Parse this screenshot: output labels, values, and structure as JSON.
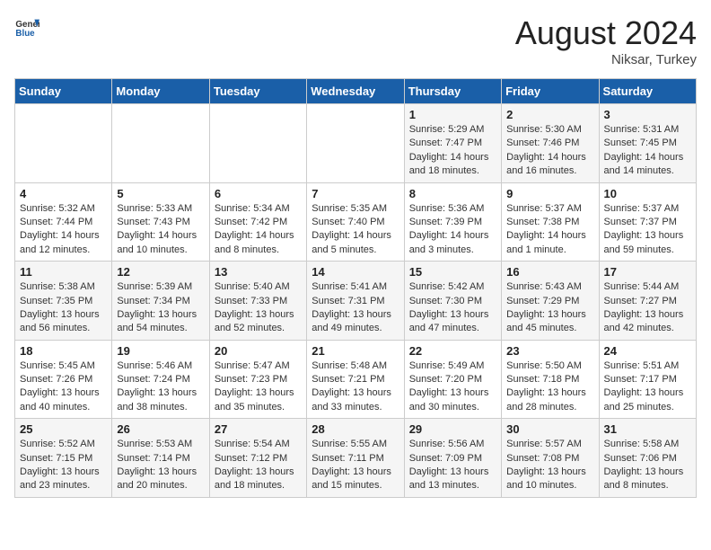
{
  "header": {
    "logo_general": "General",
    "logo_blue": "Blue",
    "month_year": "August 2024",
    "location": "Niksar, Turkey"
  },
  "weekdays": [
    "Sunday",
    "Monday",
    "Tuesday",
    "Wednesday",
    "Thursday",
    "Friday",
    "Saturday"
  ],
  "weeks": [
    [
      {
        "day": "",
        "info": ""
      },
      {
        "day": "",
        "info": ""
      },
      {
        "day": "",
        "info": ""
      },
      {
        "day": "",
        "info": ""
      },
      {
        "day": "1",
        "info": "Sunrise: 5:29 AM\nSunset: 7:47 PM\nDaylight: 14 hours\nand 18 minutes."
      },
      {
        "day": "2",
        "info": "Sunrise: 5:30 AM\nSunset: 7:46 PM\nDaylight: 14 hours\nand 16 minutes."
      },
      {
        "day": "3",
        "info": "Sunrise: 5:31 AM\nSunset: 7:45 PM\nDaylight: 14 hours\nand 14 minutes."
      }
    ],
    [
      {
        "day": "4",
        "info": "Sunrise: 5:32 AM\nSunset: 7:44 PM\nDaylight: 14 hours\nand 12 minutes."
      },
      {
        "day": "5",
        "info": "Sunrise: 5:33 AM\nSunset: 7:43 PM\nDaylight: 14 hours\nand 10 minutes."
      },
      {
        "day": "6",
        "info": "Sunrise: 5:34 AM\nSunset: 7:42 PM\nDaylight: 14 hours\nand 8 minutes."
      },
      {
        "day": "7",
        "info": "Sunrise: 5:35 AM\nSunset: 7:40 PM\nDaylight: 14 hours\nand 5 minutes."
      },
      {
        "day": "8",
        "info": "Sunrise: 5:36 AM\nSunset: 7:39 PM\nDaylight: 14 hours\nand 3 minutes."
      },
      {
        "day": "9",
        "info": "Sunrise: 5:37 AM\nSunset: 7:38 PM\nDaylight: 14 hours\nand 1 minute."
      },
      {
        "day": "10",
        "info": "Sunrise: 5:37 AM\nSunset: 7:37 PM\nDaylight: 13 hours\nand 59 minutes."
      }
    ],
    [
      {
        "day": "11",
        "info": "Sunrise: 5:38 AM\nSunset: 7:35 PM\nDaylight: 13 hours\nand 56 minutes."
      },
      {
        "day": "12",
        "info": "Sunrise: 5:39 AM\nSunset: 7:34 PM\nDaylight: 13 hours\nand 54 minutes."
      },
      {
        "day": "13",
        "info": "Sunrise: 5:40 AM\nSunset: 7:33 PM\nDaylight: 13 hours\nand 52 minutes."
      },
      {
        "day": "14",
        "info": "Sunrise: 5:41 AM\nSunset: 7:31 PM\nDaylight: 13 hours\nand 49 minutes."
      },
      {
        "day": "15",
        "info": "Sunrise: 5:42 AM\nSunset: 7:30 PM\nDaylight: 13 hours\nand 47 minutes."
      },
      {
        "day": "16",
        "info": "Sunrise: 5:43 AM\nSunset: 7:29 PM\nDaylight: 13 hours\nand 45 minutes."
      },
      {
        "day": "17",
        "info": "Sunrise: 5:44 AM\nSunset: 7:27 PM\nDaylight: 13 hours\nand 42 minutes."
      }
    ],
    [
      {
        "day": "18",
        "info": "Sunrise: 5:45 AM\nSunset: 7:26 PM\nDaylight: 13 hours\nand 40 minutes."
      },
      {
        "day": "19",
        "info": "Sunrise: 5:46 AM\nSunset: 7:24 PM\nDaylight: 13 hours\nand 38 minutes."
      },
      {
        "day": "20",
        "info": "Sunrise: 5:47 AM\nSunset: 7:23 PM\nDaylight: 13 hours\nand 35 minutes."
      },
      {
        "day": "21",
        "info": "Sunrise: 5:48 AM\nSunset: 7:21 PM\nDaylight: 13 hours\nand 33 minutes."
      },
      {
        "day": "22",
        "info": "Sunrise: 5:49 AM\nSunset: 7:20 PM\nDaylight: 13 hours\nand 30 minutes."
      },
      {
        "day": "23",
        "info": "Sunrise: 5:50 AM\nSunset: 7:18 PM\nDaylight: 13 hours\nand 28 minutes."
      },
      {
        "day": "24",
        "info": "Sunrise: 5:51 AM\nSunset: 7:17 PM\nDaylight: 13 hours\nand 25 minutes."
      }
    ],
    [
      {
        "day": "25",
        "info": "Sunrise: 5:52 AM\nSunset: 7:15 PM\nDaylight: 13 hours\nand 23 minutes."
      },
      {
        "day": "26",
        "info": "Sunrise: 5:53 AM\nSunset: 7:14 PM\nDaylight: 13 hours\nand 20 minutes."
      },
      {
        "day": "27",
        "info": "Sunrise: 5:54 AM\nSunset: 7:12 PM\nDaylight: 13 hours\nand 18 minutes."
      },
      {
        "day": "28",
        "info": "Sunrise: 5:55 AM\nSunset: 7:11 PM\nDaylight: 13 hours\nand 15 minutes."
      },
      {
        "day": "29",
        "info": "Sunrise: 5:56 AM\nSunset: 7:09 PM\nDaylight: 13 hours\nand 13 minutes."
      },
      {
        "day": "30",
        "info": "Sunrise: 5:57 AM\nSunset: 7:08 PM\nDaylight: 13 hours\nand 10 minutes."
      },
      {
        "day": "31",
        "info": "Sunrise: 5:58 AM\nSunset: 7:06 PM\nDaylight: 13 hours\nand 8 minutes."
      }
    ]
  ]
}
